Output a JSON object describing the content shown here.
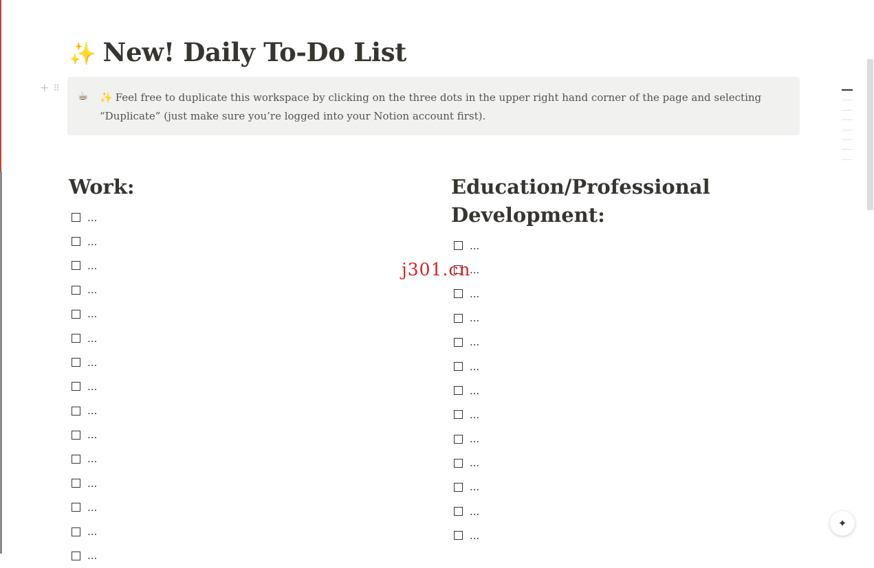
{
  "page": {
    "title_emoji": "✨",
    "title": "New! Daily To-Do List"
  },
  "block_handle": {
    "add": "+",
    "drag": "⠿"
  },
  "callout": {
    "icon": "☕",
    "spark": "✨",
    "text": "Feel free to duplicate this workspace by clicking on the three dots in the upper right hand corner of the page and selecting “Duplicate” (just make sure you’re logged into your Notion account first)."
  },
  "sections": {
    "work": {
      "heading": "Work:",
      "items": [
        "...",
        "...",
        "...",
        "...",
        "...",
        "...",
        "...",
        "...",
        "...",
        "...",
        "...",
        "...",
        "...",
        "...",
        "..."
      ]
    },
    "education": {
      "heading": "Education/Professional Development:",
      "items": [
        "...",
        "...",
        "...",
        "...",
        "...",
        "...",
        "...",
        "...",
        "...",
        "...",
        "...",
        "...",
        "..."
      ]
    }
  },
  "watermark": "j301.cn",
  "ai_button": {
    "icon": "sparkle-icon",
    "glyph": "✦"
  },
  "colors": {
    "text": "#37352f",
    "callout_bg": "#f1f1ef",
    "watermark": "#d42323"
  }
}
